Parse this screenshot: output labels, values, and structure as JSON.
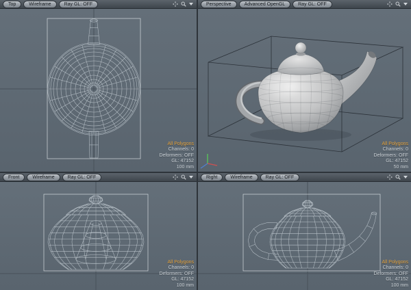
{
  "app": {
    "name": "3D modeling quad viewport"
  },
  "colors": {
    "viewport_bg": "#5e6a74",
    "selection_orange": "#e5a23c",
    "wireframe": "#b9c2c9",
    "axis_x_red": "#d05050",
    "axis_y_green": "#57c957",
    "axis_z_blue": "#5080d0"
  },
  "icons": {
    "pan": "pan-icon",
    "zoom": "zoom-icon",
    "menu": "viewport-menu-icon"
  },
  "viewports": [
    {
      "view": "Top",
      "shading": "Wireframe",
      "raygl": "Ray GL: OFF",
      "info": {
        "selection": "All Polygons",
        "channels": "Channels: 0",
        "deformers": "Deformers: OFF",
        "gl": "GL: 47152",
        "grid": "100 mm"
      }
    },
    {
      "view": "Perspective",
      "shading": "Advanced OpenGL",
      "raygl": "Ray GL: OFF",
      "info": {
        "selection": "All Polygons",
        "channels": "Channels: 0",
        "deformers": "Deformers: OFF",
        "gl": "GL: 47152",
        "grid": "50 mm"
      }
    },
    {
      "view": "Front",
      "shading": "Wireframe",
      "raygl": "Ray GL: OFF",
      "info": {
        "selection": "All Polygons",
        "channels": "Channels: 0",
        "deformers": "Deformers: OFF",
        "gl": "GL: 47152",
        "grid": "100 mm"
      }
    },
    {
      "view": "Right",
      "shading": "Wireframe",
      "raygl": "Ray GL: OFF",
      "info": {
        "selection": "All Polygons",
        "channels": "Channels: 0",
        "deformers": "Deformers: OFF",
        "gl": "GL: 47152",
        "grid": "100 mm"
      }
    }
  ]
}
